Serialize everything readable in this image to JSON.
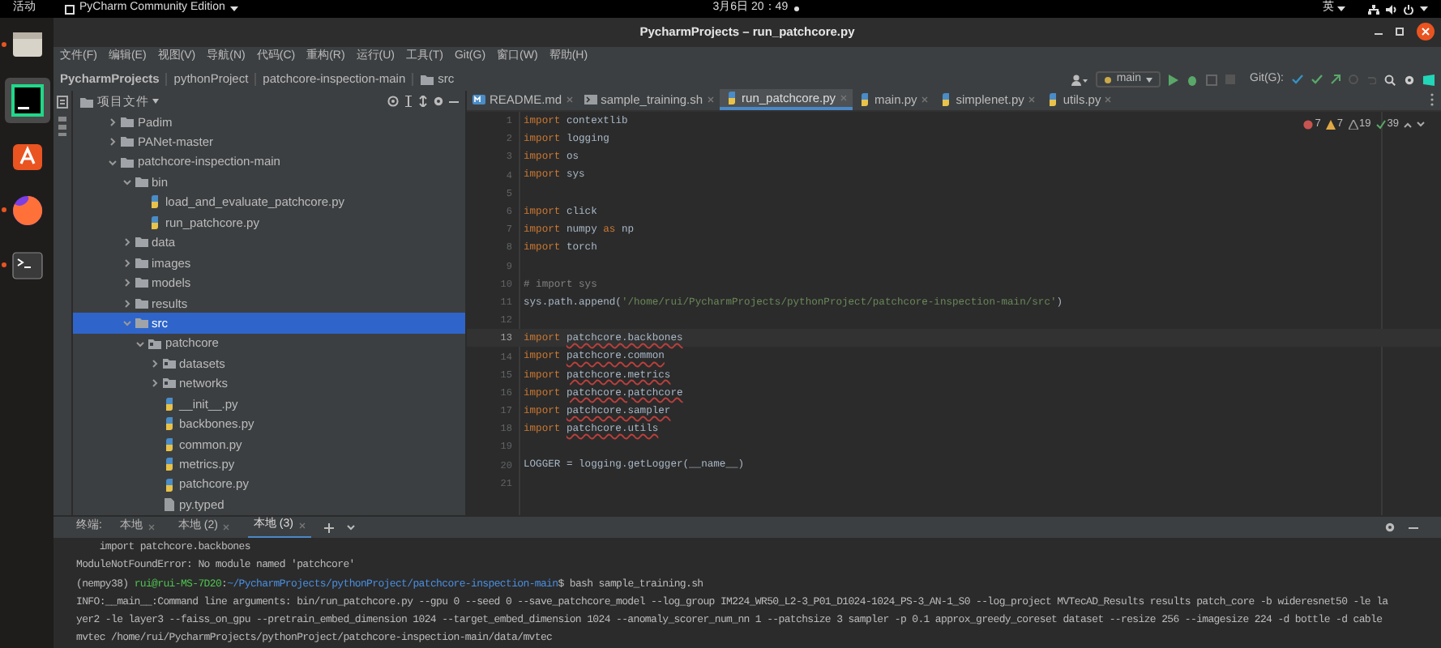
{
  "top_bar": {
    "activities": "活动",
    "app_menu": "PyCharm Community Edition",
    "clock": "3月6日 20：49",
    "input_method": "英"
  },
  "dock": [
    {
      "kind": "files",
      "active": false,
      "running": true
    },
    {
      "kind": "ide",
      "active": true,
      "running": false
    },
    {
      "kind": "store",
      "active": false,
      "running": false
    },
    {
      "kind": "browser",
      "active": false,
      "running": true
    },
    {
      "kind": "terminal",
      "active": false,
      "running": true
    }
  ],
  "window": {
    "title": "PycharmProjects – run_patchcore.py"
  },
  "menu": [
    "文件(F)",
    "编辑(E)",
    "视图(V)",
    "导航(N)",
    "代码(C)",
    "重构(R)",
    "运行(U)",
    "工具(T)",
    "Git(G)",
    "窗口(W)",
    "帮助(H)"
  ],
  "breadcrumbs": [
    {
      "label": "PycharmProjects",
      "kind": "root"
    },
    {
      "label": "pythonProject",
      "kind": "plain"
    },
    {
      "label": "patchcore-inspection-main",
      "kind": "plain"
    },
    {
      "label": "src",
      "kind": "folder"
    }
  ],
  "toolbar": {
    "branch": "main",
    "git_label": "Git(G):"
  },
  "project_panel": {
    "title": "项目文件",
    "tree": [
      {
        "name": "Padim",
        "kind": "folder",
        "expanded": false,
        "selected": false
      },
      {
        "name": "PANet-master",
        "kind": "folder",
        "expanded": false,
        "selected": false
      },
      {
        "name": "patchcore-inspection-main",
        "kind": "folder",
        "expanded": true,
        "selected": false,
        "children": [
          {
            "name": "bin",
            "kind": "folder",
            "expanded": true,
            "selected": false,
            "children": [
              {
                "name": "load_and_evaluate_patchcore.py",
                "kind": "python",
                "selected": false
              },
              {
                "name": "run_patchcore.py",
                "kind": "python",
                "selected": false
              }
            ]
          },
          {
            "name": "data",
            "kind": "folder",
            "expanded": false,
            "selected": false
          },
          {
            "name": "images",
            "kind": "folder",
            "expanded": false,
            "selected": false
          },
          {
            "name": "models",
            "kind": "folder",
            "expanded": false,
            "selected": false
          },
          {
            "name": "results",
            "kind": "folder",
            "expanded": false,
            "selected": false
          },
          {
            "name": "src",
            "kind": "folder",
            "expanded": true,
            "selected": true,
            "children": [
              {
                "name": "patchcore",
                "kind": "package",
                "expanded": true,
                "selected": false,
                "children": [
                  {
                    "name": "datasets",
                    "kind": "package",
                    "expanded": false,
                    "selected": false
                  },
                  {
                    "name": "networks",
                    "kind": "package",
                    "expanded": false,
                    "selected": false
                  },
                  {
                    "name": "__init__.py",
                    "kind": "python",
                    "selected": false
                  },
                  {
                    "name": "backbones.py",
                    "kind": "python",
                    "selected": false
                  },
                  {
                    "name": "common.py",
                    "kind": "python",
                    "selected": false
                  },
                  {
                    "name": "metrics.py",
                    "kind": "python",
                    "selected": false
                  },
                  {
                    "name": "patchcore.py",
                    "kind": "python",
                    "selected": false
                  },
                  {
                    "name": "py.typed",
                    "kind": "file",
                    "selected": false
                  }
                ]
              }
            ]
          }
        ]
      }
    ]
  },
  "editor": {
    "tabs": [
      {
        "label": "README.md",
        "kind": "markdown",
        "selected": false
      },
      {
        "label": "sample_training.sh",
        "kind": "shell",
        "selected": false
      },
      {
        "label": "run_patchcore.py",
        "kind": "python",
        "selected": true
      },
      {
        "label": "main.py",
        "kind": "python",
        "selected": false
      },
      {
        "label": "simplenet.py",
        "kind": "python",
        "selected": false
      },
      {
        "label": "utils.py",
        "kind": "python",
        "selected": false
      }
    ],
    "inspections": [
      {
        "kind": "error",
        "count": "7"
      },
      {
        "kind": "warning",
        "count": "7"
      },
      {
        "kind": "weak",
        "count": "19"
      },
      {
        "kind": "typo",
        "count": "39"
      }
    ],
    "lines": [
      {
        "n": "1",
        "current": false,
        "tokens": [
          {
            "kind": "kw",
            "text": "import"
          },
          {
            "kind": "plain",
            "text": " contextlib"
          }
        ]
      },
      {
        "n": "2",
        "current": false,
        "tokens": [
          {
            "kind": "kw",
            "text": "import"
          },
          {
            "kind": "plain",
            "text": " logging"
          }
        ]
      },
      {
        "n": "3",
        "current": false,
        "tokens": [
          {
            "kind": "kw",
            "text": "import"
          },
          {
            "kind": "plain",
            "text": " os"
          }
        ]
      },
      {
        "n": "4",
        "current": false,
        "tokens": [
          {
            "kind": "kw",
            "text": "import"
          },
          {
            "kind": "plain",
            "text": " sys"
          }
        ]
      },
      {
        "n": "5",
        "current": false
      },
      {
        "n": "6",
        "current": false,
        "tokens": [
          {
            "kind": "kw",
            "text": "import"
          },
          {
            "kind": "plain",
            "text": " click"
          }
        ]
      },
      {
        "n": "7",
        "current": false,
        "tokens": [
          {
            "kind": "kw",
            "text": "import"
          },
          {
            "kind": "plain",
            "text": " numpy "
          },
          {
            "kind": "kw",
            "text": "as"
          },
          {
            "kind": "plain",
            "text": " np"
          }
        ]
      },
      {
        "n": "8",
        "current": false,
        "tokens": [
          {
            "kind": "kw",
            "text": "import"
          },
          {
            "kind": "plain",
            "text": " torch"
          }
        ]
      },
      {
        "n": "9",
        "current": false
      },
      {
        "n": "10",
        "current": false,
        "tokens": [
          {
            "kind": "comment",
            "text": "# import sys"
          }
        ]
      },
      {
        "n": "11",
        "current": false,
        "tokens": [
          {
            "kind": "plain",
            "text": "sys.path.append("
          },
          {
            "kind": "string",
            "text": "'/home/rui/PycharmProjects/pythonProject/patchcore-inspection-main/src'"
          },
          {
            "kind": "plain",
            "text": ")"
          }
        ]
      },
      {
        "n": "12",
        "current": false
      },
      {
        "n": "13",
        "current": true,
        "tokens": [
          {
            "kind": "kw",
            "text": "import "
          },
          {
            "kind": "unresolved",
            "text": "patchcore.backbones"
          }
        ]
      },
      {
        "n": "14",
        "current": false,
        "tokens": [
          {
            "kind": "kw",
            "text": "import "
          },
          {
            "kind": "unresolved",
            "text": "patchcore.common"
          }
        ]
      },
      {
        "n": "15",
        "current": false,
        "tokens": [
          {
            "kind": "kw",
            "text": "import "
          },
          {
            "kind": "unresolved",
            "text": "patchcore.metrics"
          }
        ]
      },
      {
        "n": "16",
        "current": false,
        "tokens": [
          {
            "kind": "kw",
            "text": "import "
          },
          {
            "kind": "unresolved",
            "text": "patchcore.patchcore"
          }
        ]
      },
      {
        "n": "17",
        "current": false,
        "tokens": [
          {
            "kind": "kw",
            "text": "import "
          },
          {
            "kind": "unresolved",
            "text": "patchcore.sampler"
          }
        ]
      },
      {
        "n": "18",
        "current": false,
        "tokens": [
          {
            "kind": "kw",
            "text": "import "
          },
          {
            "kind": "unresolved",
            "text": "patchcore.utils"
          }
        ]
      },
      {
        "n": "19",
        "current": false
      },
      {
        "n": "20",
        "current": false,
        "tokens": [
          {
            "kind": "plain",
            "text": "LOGGER = logging.getLogger(__name__)"
          }
        ]
      },
      {
        "n": "21",
        "current": false
      }
    ]
  },
  "terminal": {
    "label": "终端:",
    "tabs": [
      {
        "label": "本地",
        "selected": false
      },
      {
        "label": "本地 (2)",
        "selected": false
      },
      {
        "label": "本地 (3)",
        "selected": true
      }
    ],
    "lines": [
      [
        {
          "kind": "plain",
          "text": "    import patchcore.backbones"
        }
      ],
      [
        {
          "kind": "plain",
          "text": "ModuleNotFoundError: No module named 'patchcore'"
        }
      ],
      [
        {
          "kind": "plain",
          "text": "(nempy38) "
        },
        {
          "kind": "user",
          "text": "rui@rui-MS-7D20"
        },
        {
          "kind": "plain",
          "text": ":"
        },
        {
          "kind": "path",
          "text": "~/PycharmProjects/pythonProject/patchcore-inspection-main"
        },
        {
          "kind": "plain",
          "text": "$ bash sample_training.sh"
        }
      ],
      [
        {
          "kind": "plain",
          "text": "INFO:__main__:Command line arguments: bin/run_patchcore.py --gpu 0 --seed 0 --save_patchcore_model --log_group IM224_WR50_L2-3_P01_D1024-1024_PS-3_AN-1_S0 --log_project MVTecAD_Results results patch_core -b wideresnet50 -le la"
        }
      ],
      [
        {
          "kind": "plain",
          "text": "yer2 -le layer3 --faiss_on_gpu --pretrain_embed_dimension 1024 --target_embed_dimension 1024 --anomaly_scorer_num_nn 1 --patchsize 3 sampler -p 0.1 approx_greedy_coreset dataset --resize 256 --imagesize 224 -d bottle -d cable"
        }
      ],
      [
        {
          "kind": "plain",
          "text": "mvtec /home/rui/PycharmProjects/pythonProject/patchcore-inspection-main/data/mvtec"
        }
      ]
    ]
  }
}
